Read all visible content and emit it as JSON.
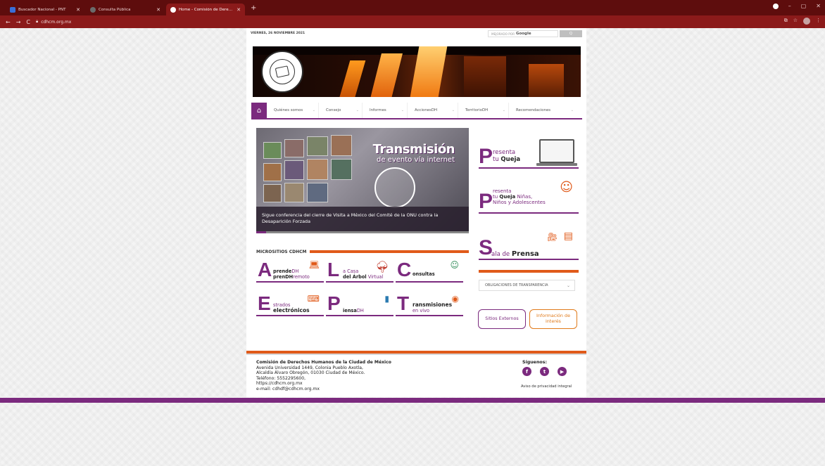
{
  "browser": {
    "tabs": [
      {
        "title": "Buscador Nacional - PNT",
        "favicon_color": "#3a6fd8",
        "active": false
      },
      {
        "title": "Consulta Pública",
        "favicon_color": "#6b6b6b",
        "active": false
      },
      {
        "title": "Home - Comisión de Derechos H",
        "favicon_color": "#ffffff",
        "active": true
      }
    ],
    "new_tab": "+",
    "url": "cdhcm.org.mx",
    "colors": {
      "tabbar": "#5e0d0d",
      "toolbar": "#8b1a1a"
    }
  },
  "header": {
    "date": "VIERNES, 26 NOVIEMBRE 2021",
    "search_placeholder": "MEJORADO POR",
    "search_brand": "Google",
    "search_button": "Q"
  },
  "nav": {
    "items": [
      "Quiénes somos",
      "Consejo",
      "Informes",
      "AccionesDH",
      "TerritorioDH",
      "Recomendaciones"
    ]
  },
  "feature": {
    "title": "Transmisión",
    "subtitle": "de evento vía internet",
    "caption": "Sigue conferencia del cierre de Visita a México del Comité de la ONU contra la Desaparición Forzada"
  },
  "microsites": {
    "heading": "MICROSITIOS CDHCM",
    "tiles": [
      {
        "letter": "A",
        "line1_bold": "prende",
        "line1": "DH",
        "line2_bold": "prenDH",
        "line2": "remoto"
      },
      {
        "letter": "L",
        "line1_bold": "",
        "line1": "a Casa",
        "line2_bold": "del Árbol",
        "line2": " Virtual"
      },
      {
        "letter": "C",
        "line1_bold": "",
        "line1": "",
        "line2_bold": "onsultas",
        "line2": ""
      },
      {
        "letter": "E",
        "line1_bold": "",
        "line1": "strados",
        "line2_bold": "electrónicos",
        "line2": ""
      },
      {
        "letter": "P",
        "line1_bold": "",
        "line1": "",
        "line2_bold": "iensa",
        "line2": "DH"
      },
      {
        "letter": "T",
        "line1_bold": "ransmisiones",
        "line1": "",
        "line2_bold": "",
        "line2": "en vivo"
      }
    ]
  },
  "sidebar": {
    "queja": {
      "letter": "P",
      "line1": "resenta",
      "line2_pre": "tu ",
      "line2_bold": "Queja"
    },
    "queja_ninos": {
      "letter": "P",
      "line1": "resenta",
      "line2_pre": "tu ",
      "line2_bold": "Queja",
      "line2_post": " Niñas,",
      "line3": "Niños y Adolescentes"
    },
    "prensa": {
      "letter": "S",
      "line_pre": "ala de ",
      "line_bold": "Prensa"
    },
    "transparencia_select": "OBLIGACIONES DE TRANSPARENCIA",
    "buttons": [
      "Sitios Externos",
      "Información de interés"
    ]
  },
  "footer": {
    "org": "Comisión de Derechos Humanos de la Ciudad de México",
    "lines": [
      "Avenida Universidad 1449, Colonia Pueblo Axotla,",
      "Alcaldía Álvaro Obregón, 01030 Ciudad de México.",
      "Teléfono: 5552295600,",
      "https://cdhcm.org.mx",
      "e-mail: cdhdf@cdhcm.org.mx"
    ],
    "follow": "Síguenos:",
    "social": [
      "f",
      "t",
      "▶"
    ],
    "privacy": "Aviso de privacidad integral"
  },
  "colors": {
    "purple": "#7b2a7e",
    "orange": "#e05a1a"
  }
}
